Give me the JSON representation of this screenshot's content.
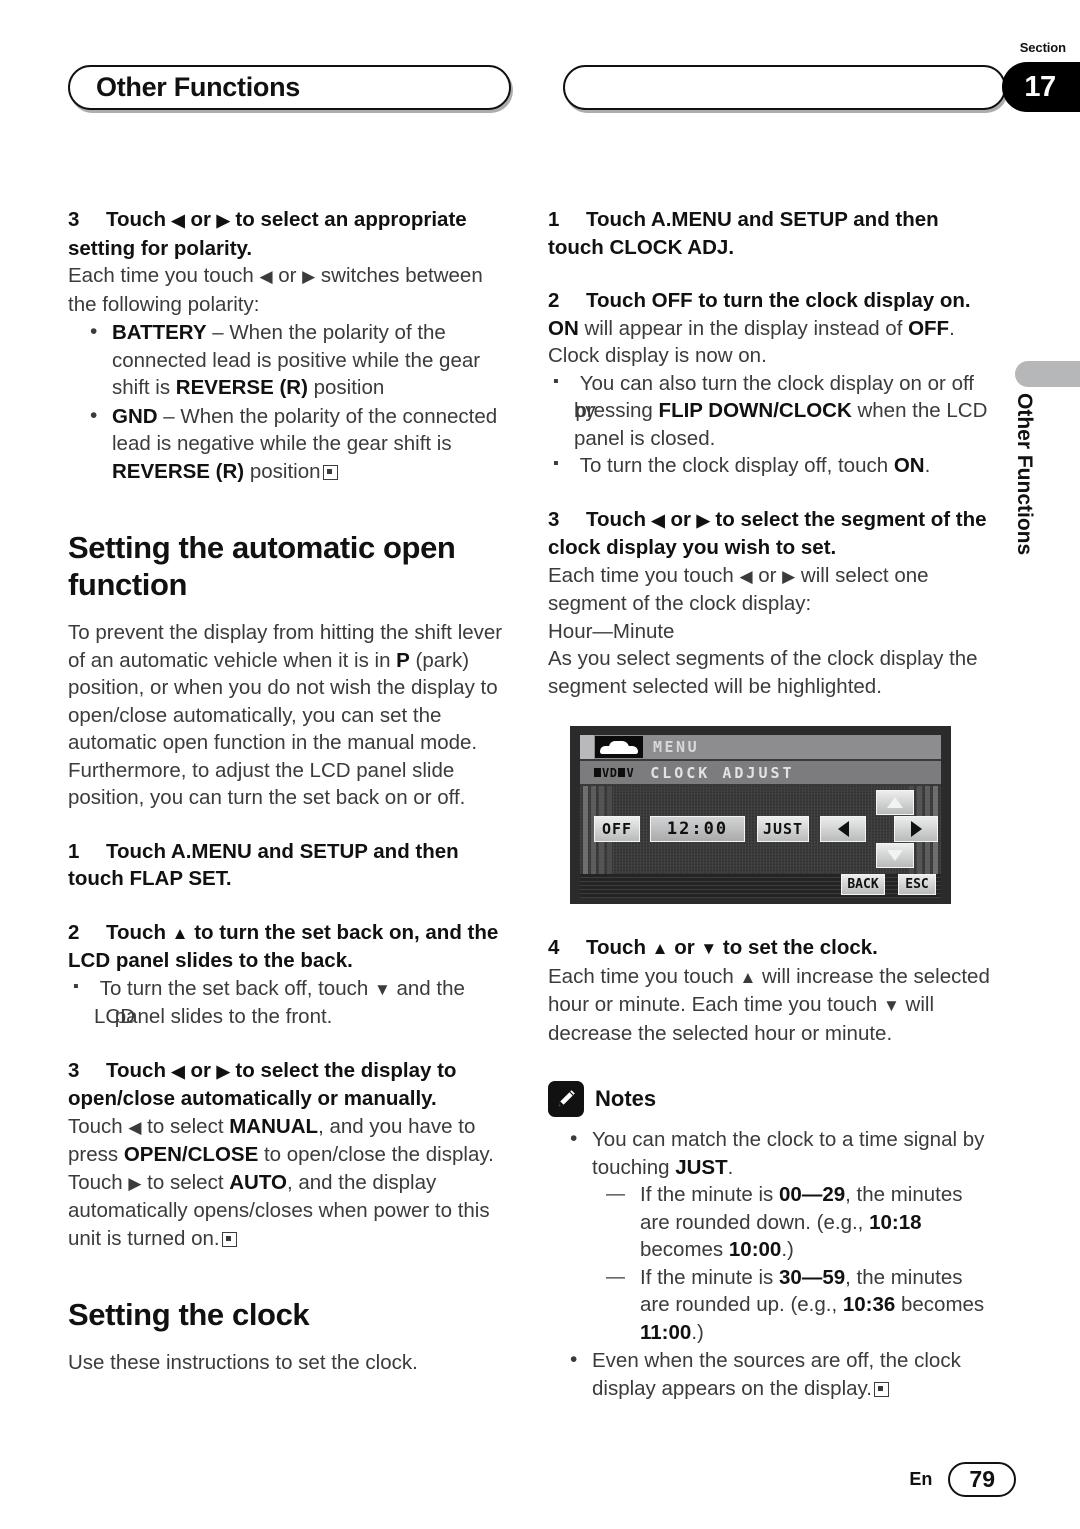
{
  "header": {
    "left_title": "Other Functions",
    "right_title": "",
    "section_label": "Section",
    "section_number": "17"
  },
  "side_tab": {
    "label": "Other Functions"
  },
  "left_column": {
    "step3_polarity": {
      "num": "3",
      "title": "Touch ◀ or ▶ to select an appropriate setting for polarity.",
      "body": "Each time you touch ◀ or ▶ switches between the following polarity:",
      "bullets": [
        "BATTERY – When the polarity of the connected lead is positive while the gear shift is REVERSE (R) position",
        "GND – When the polarity of the connected lead is negative while the gear shift is REVERSE (R) position"
      ]
    },
    "heading_auto_open": "Setting the automatic open function",
    "auto_open_intro_1": "To prevent the display from hitting the shift lever of an automatic vehicle when it is in P (park) position, or when you do not wish the display to open/close automatically, you can set the automatic open function in the manual mode.",
    "auto_open_intro_2": "Furthermore, to adjust the LCD panel slide position, you can turn the set back on or off.",
    "step1_flap": {
      "num": "1",
      "title": "Touch A.MENU and SETUP and then touch FLAP SET."
    },
    "step2_flap": {
      "num": "2",
      "title": "Touch ▲ to turn the set back on, and the LCD panel slides to the back.",
      "note": "To turn the set back off, touch ▼ and the LCD panel slides to the front."
    },
    "step3_flap": {
      "num": "3",
      "title": "Touch ◀ or ▶ to select the display to open/close automatically or manually.",
      "body": "Touch ◀ to select MANUAL, and you have to press OPEN/CLOSE to open/close the display. Touch ▶ to select AUTO, and the display automatically opens/closes when power to this unit is turned on."
    },
    "heading_clock": "Setting the clock",
    "clock_intro": "Use these instructions to set the clock."
  },
  "right_column": {
    "step1_clock": {
      "num": "1",
      "title": "Touch A.MENU and SETUP and then touch CLOCK ADJ."
    },
    "step2_clock": {
      "num": "2",
      "title": "Touch OFF to turn the clock display on.",
      "body": "ON will appear in the display instead of OFF. Clock display is now on.",
      "notes": [
        "You can also turn the clock display on or off by pressing FLIP DOWN/CLOCK when the LCD panel is closed.",
        "To turn the clock display off, touch ON."
      ]
    },
    "step3_clock": {
      "num": "3",
      "title": "Touch ◀ or ▶ to select the segment of the clock display you wish to set.",
      "body_1": "Each time you touch ◀ or ▶ will select one segment of the clock display:",
      "body_2": "Hour—Minute",
      "body_3": "As you select segments of the clock display the segment selected will be highlighted."
    },
    "step4_clock": {
      "num": "4",
      "title": "Touch ▲ or ▼ to set the clock.",
      "body": "Each time you touch ▲ will increase the selected hour or minute. Each time you touch ▼ will decrease the selected hour or minute."
    },
    "notes_heading": "Notes",
    "notes": {
      "bullet_1": "You can match the clock to a time signal by touching JUST.",
      "sub_1": "If the minute is 00—29, the minutes are rounded down. (e.g., 10:18 becomes 10:00.)",
      "sub_2": "If the minute is 30—59, the minutes are rounded up. (e.g., 10:36 becomes 11:00.)",
      "bullet_2": "Even when the sources are off, the clock display appears on the display."
    }
  },
  "lcd_figure": {
    "title_bar": "MENU",
    "disc_badge": "DVD-V",
    "subtitle_bar": "CLOCK ADJUST",
    "off_button": "OFF",
    "time_value": "12:00",
    "just_button": "JUST",
    "back_button": "BACK",
    "esc_button": "ESC"
  },
  "footer": {
    "language": "En",
    "page": "79"
  }
}
